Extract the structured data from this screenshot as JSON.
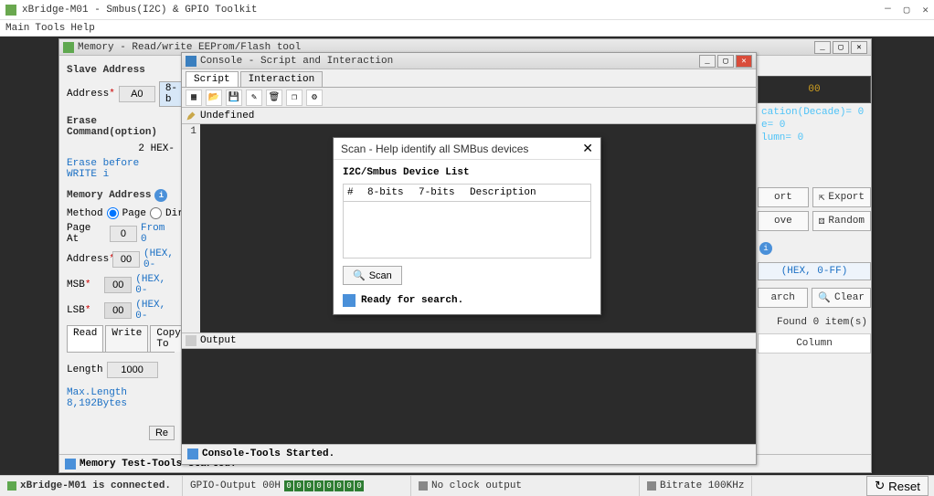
{
  "app": {
    "title": "xBridge-M01 - Smbus(I2C) & GPIO Toolkit",
    "menu": [
      "Main",
      "Tools",
      "Help"
    ]
  },
  "memwin": {
    "title": "Memory - Read/write EEProm/Flash tool",
    "slave_address_label": "Slave Address",
    "address_label": "Address",
    "address_value": "A0",
    "addr_fmt": "8-b",
    "erase_label": "Erase Command(option)",
    "erase_hex": "2 HEX-",
    "erase_link": "Erase before WRITE i",
    "mem_addr_label": "Memory Address",
    "method_label": "Method",
    "method_page": "Page",
    "method_dir": "Dir",
    "page_at_label": "Page At",
    "page_at_value": "0",
    "page_from": "From 0",
    "addr2_label": "Address",
    "addr2_value": "00",
    "hex_hint": "(HEX, 0-",
    "msb_label": "MSB",
    "msb_value": "00",
    "lsb_label": "LSB",
    "lsb_value": "00",
    "tabs": [
      "Read",
      "Write",
      "Copy To"
    ],
    "length_label": "Length",
    "length_value": "1000",
    "max_len": "Max.Length 8,192Bytes",
    "read_btn": "Re",
    "status": "Memory Test-Tools Started."
  },
  "console": {
    "title": "Console - Script and Interaction",
    "tabs": {
      "script": "Script",
      "interaction": "Interaction"
    },
    "undefined_label": "Undefined",
    "line1": "1",
    "output_label": "Output",
    "status": "Console-Tools Started."
  },
  "scan": {
    "title": "Scan - Help identify all SMBus devices",
    "list_title": "I2C/Smbus Device List",
    "cols": [
      "#",
      "8-bits",
      "7-bits",
      "Description"
    ],
    "scan_btn": "Scan",
    "ready": "Ready for search."
  },
  "right": {
    "top_value": "00",
    "lines": [
      "cation(Decade)= 0",
      "e= 0",
      "lumn= 0"
    ],
    "export_part": "ort",
    "export": "Export",
    "move_part": "ove",
    "random": "Random",
    "hex_hint": "(HEX, 0-FF)",
    "arch_part": "arch",
    "clear": "Clear",
    "found": "Found 0 item(s)",
    "column": "Column"
  },
  "status": {
    "connected": "xBridge-M01 is connected.",
    "gpio": "GPIO-Output 00H",
    "clock": "No clock output",
    "bitrate": "Bitrate 100KHz",
    "reset": "Reset"
  }
}
